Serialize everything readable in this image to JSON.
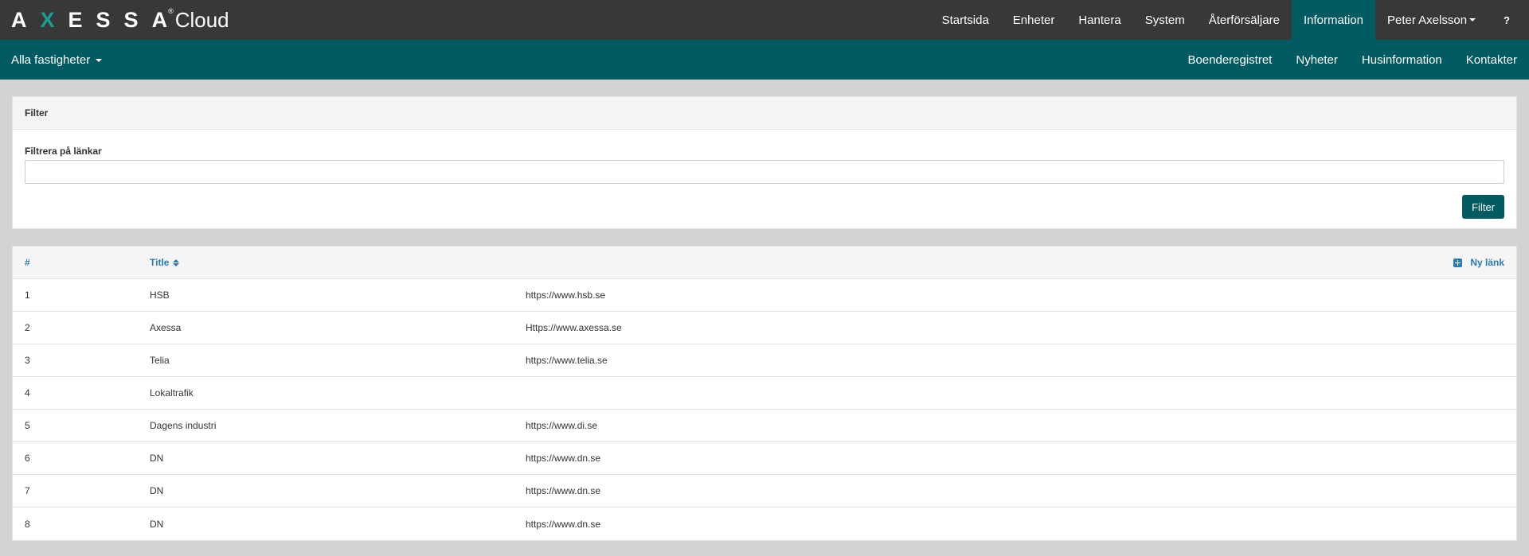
{
  "app": {
    "logo_letters": [
      "A",
      "X",
      "E",
      "S",
      "S",
      "A"
    ],
    "logo_reg": "®",
    "logo_suffix": "Cloud"
  },
  "topnav": {
    "items": [
      {
        "label": "Startsida"
      },
      {
        "label": "Enheter"
      },
      {
        "label": "Hantera"
      },
      {
        "label": "System"
      },
      {
        "label": "Återförsäljare"
      },
      {
        "label": "Information",
        "active": true
      },
      {
        "label": "Peter Axelsson"
      },
      {
        "label": "?"
      }
    ]
  },
  "subbar": {
    "property_select": "Alla fastigheter",
    "items": [
      {
        "label": "Boenderegistret"
      },
      {
        "label": "Nyheter"
      },
      {
        "label": "Husinformation"
      },
      {
        "label": "Kontakter"
      }
    ]
  },
  "filter": {
    "heading": "Filter",
    "label": "Filtrera på länkar",
    "value": "",
    "placeholder": "",
    "button": "Filter"
  },
  "links_table": {
    "headers": {
      "num": "#",
      "title": "Title"
    },
    "new_link": "Ny länk",
    "rows": [
      {
        "num": "1",
        "title": "HSB",
        "url": "https://www.hsb.se"
      },
      {
        "num": "2",
        "title": "Axessa",
        "url": "Https://www.axessa.se"
      },
      {
        "num": "3",
        "title": "Telia",
        "url": "https://www.telia.se"
      },
      {
        "num": "4",
        "title": "Lokaltrafik",
        "url": ""
      },
      {
        "num": "5",
        "title": "Dagens industri",
        "url": "https://www.di.se"
      },
      {
        "num": "6",
        "title": "DN",
        "url": "https://www.dn.se"
      },
      {
        "num": "7",
        "title": "DN",
        "url": "https://www.dn.se"
      },
      {
        "num": "8",
        "title": "DN",
        "url": "https://www.dn.se"
      }
    ]
  },
  "colors": {
    "topbar": "#383838",
    "brand_teal": "#025a63",
    "logo_x": "#1e9e92",
    "link_blue": "#2a7ab5",
    "page_bg": "#d3d3d3"
  },
  "icons": {
    "user_caret": "chevron-down-icon",
    "property_caret": "chevron-down-icon",
    "sort": "sort-icon",
    "new_link": "plus-square-icon"
  }
}
